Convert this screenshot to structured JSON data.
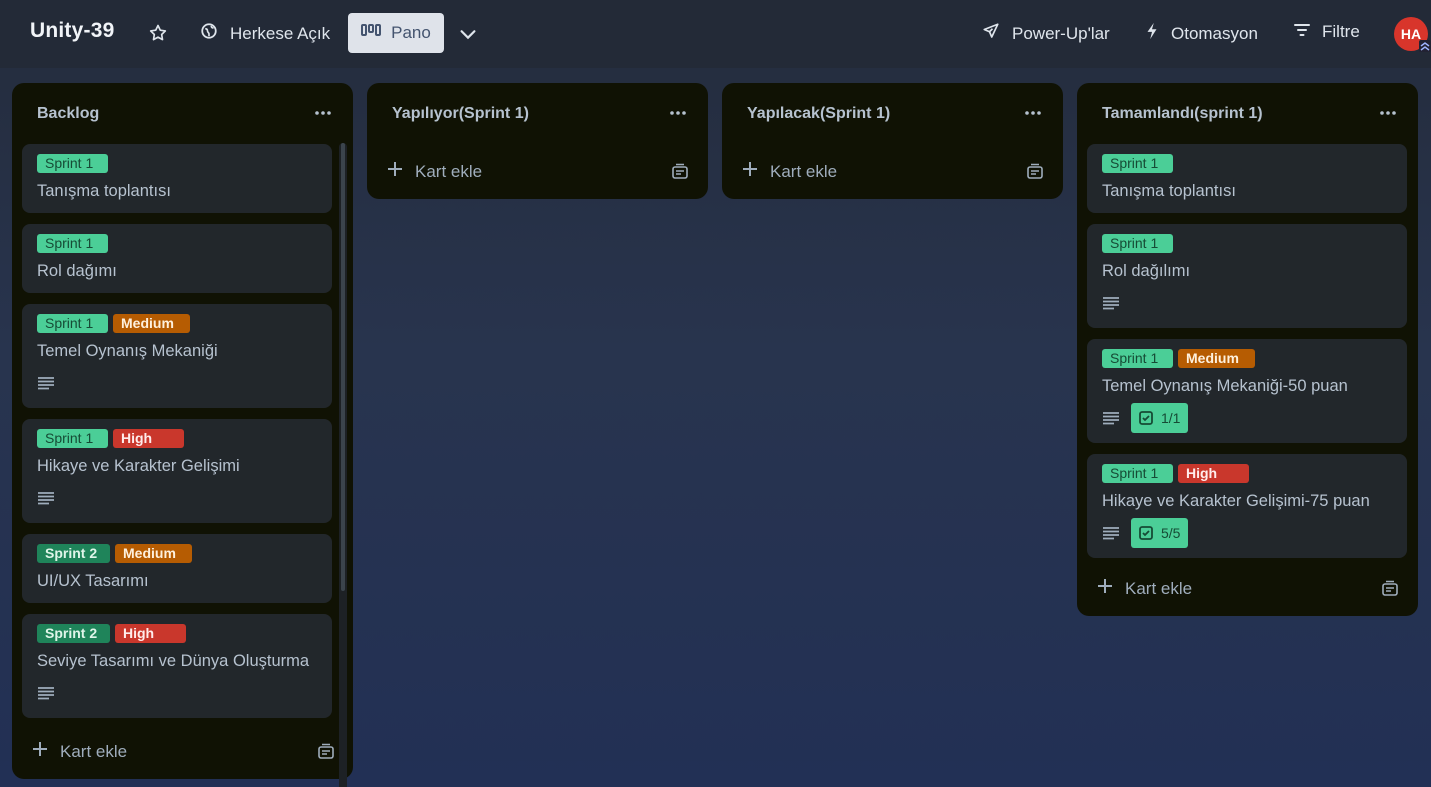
{
  "header": {
    "board_title": "Unity-39",
    "visibility_label": "Herkese Açık",
    "view_label": "Pano",
    "powerups_label": "Power-Up'lar",
    "automation_label": "Otomasyon",
    "filter_label": "Filtre",
    "avatar_initials": "HA"
  },
  "lists": [
    {
      "title": "Backlog",
      "add_card_label": "Kart ekle",
      "cards": [
        {
          "labels": [
            "Sprint 1"
          ],
          "title": "Tanışma toplantısı"
        },
        {
          "labels": [
            "Sprint 1"
          ],
          "title": "Rol dağımı"
        },
        {
          "labels": [
            "Sprint 1",
            "Medium"
          ],
          "title": "Temel Oynanış Mekaniği",
          "description_icon": "description-icon"
        },
        {
          "labels": [
            "Sprint 1",
            "High"
          ],
          "title": "Hikaye ve Karakter Gelişimi",
          "description_icon": "description-icon"
        },
        {
          "labels": [
            "Sprint 2",
            "Medium"
          ],
          "title": "UI/UX Tasarımı"
        },
        {
          "labels": [
            "Sprint 2",
            "High"
          ],
          "title": "Seviye Tasarımı ve Dünya Oluşturma",
          "description_icon": "description-icon"
        }
      ]
    },
    {
      "title": "Yapılıyor(Sprint 1)",
      "add_card_label": "Kart ekle",
      "cards": []
    },
    {
      "title": "Yapılacak(Sprint 1)",
      "add_card_label": "Kart ekle",
      "cards": []
    },
    {
      "title": "Tamamlandı(sprint 1)",
      "add_card_label": "Kart ekle",
      "cards": [
        {
          "labels": [
            "Sprint 1"
          ],
          "title": "Tanışma toplantısı"
        },
        {
          "labels": [
            "Sprint 1"
          ],
          "title": "Rol dağılımı",
          "description_icon": "description-icon"
        },
        {
          "labels": [
            "Sprint 1",
            "Medium"
          ],
          "title": "Temel Oynanış Mekaniği-50 puan",
          "description_icon": "description-icon",
          "checklist": "1/1"
        },
        {
          "labels": [
            "Sprint 1",
            "High"
          ],
          "title": "Hikaye ve Karakter Gelişimi-75 puan",
          "description_icon": "description-icon",
          "checklist": "5/5"
        }
      ]
    }
  ],
  "colors": {
    "sprint1": "#4bce97",
    "sprint2": "#1f845a",
    "medium": "#b65c02",
    "high": "#c9372c",
    "list_bg": "#101204",
    "card_bg": "#22272b"
  }
}
